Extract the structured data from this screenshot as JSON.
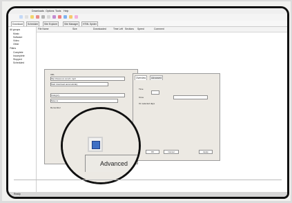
{
  "menu": {
    "items": [
      "Downloads",
      "Options",
      "Tools",
      "Help"
    ]
  },
  "tabs": [
    "Download",
    "Scheduler",
    "Site Explorer",
    "Site Manager",
    "HTML Spider"
  ],
  "tree": {
    "root": "All groups",
    "children": [
      "Music",
      "Software",
      "Video",
      "Other",
      "Filters",
      "Complete",
      "Incomplete",
      "Stopped",
      "Scheduled"
    ]
  },
  "columns": [
    "File Name",
    "Size",
    "Downloaded",
    "Time Left",
    "Sections",
    "Speed",
    "Comment"
  ],
  "dialog_left": {
    "url_label": "URL",
    "url_value": "http://www.xxx.com/m.mp3",
    "checkbox_label": "Start download automatically",
    "category_label": "Category",
    "save_label": "Save to",
    "remember_label": "Remember",
    "advanced_label": "Advanced"
  },
  "dialog_right": {
    "tabs": [
      "Overview",
      "Advanced"
    ],
    "time_label": "Time",
    "apply_button": "Apply",
    "cancel_button": "Cancel",
    "ok_button": "OK",
    "options": [
      "Once",
      "On selected days"
    ]
  },
  "status": {
    "text": "Ready"
  }
}
